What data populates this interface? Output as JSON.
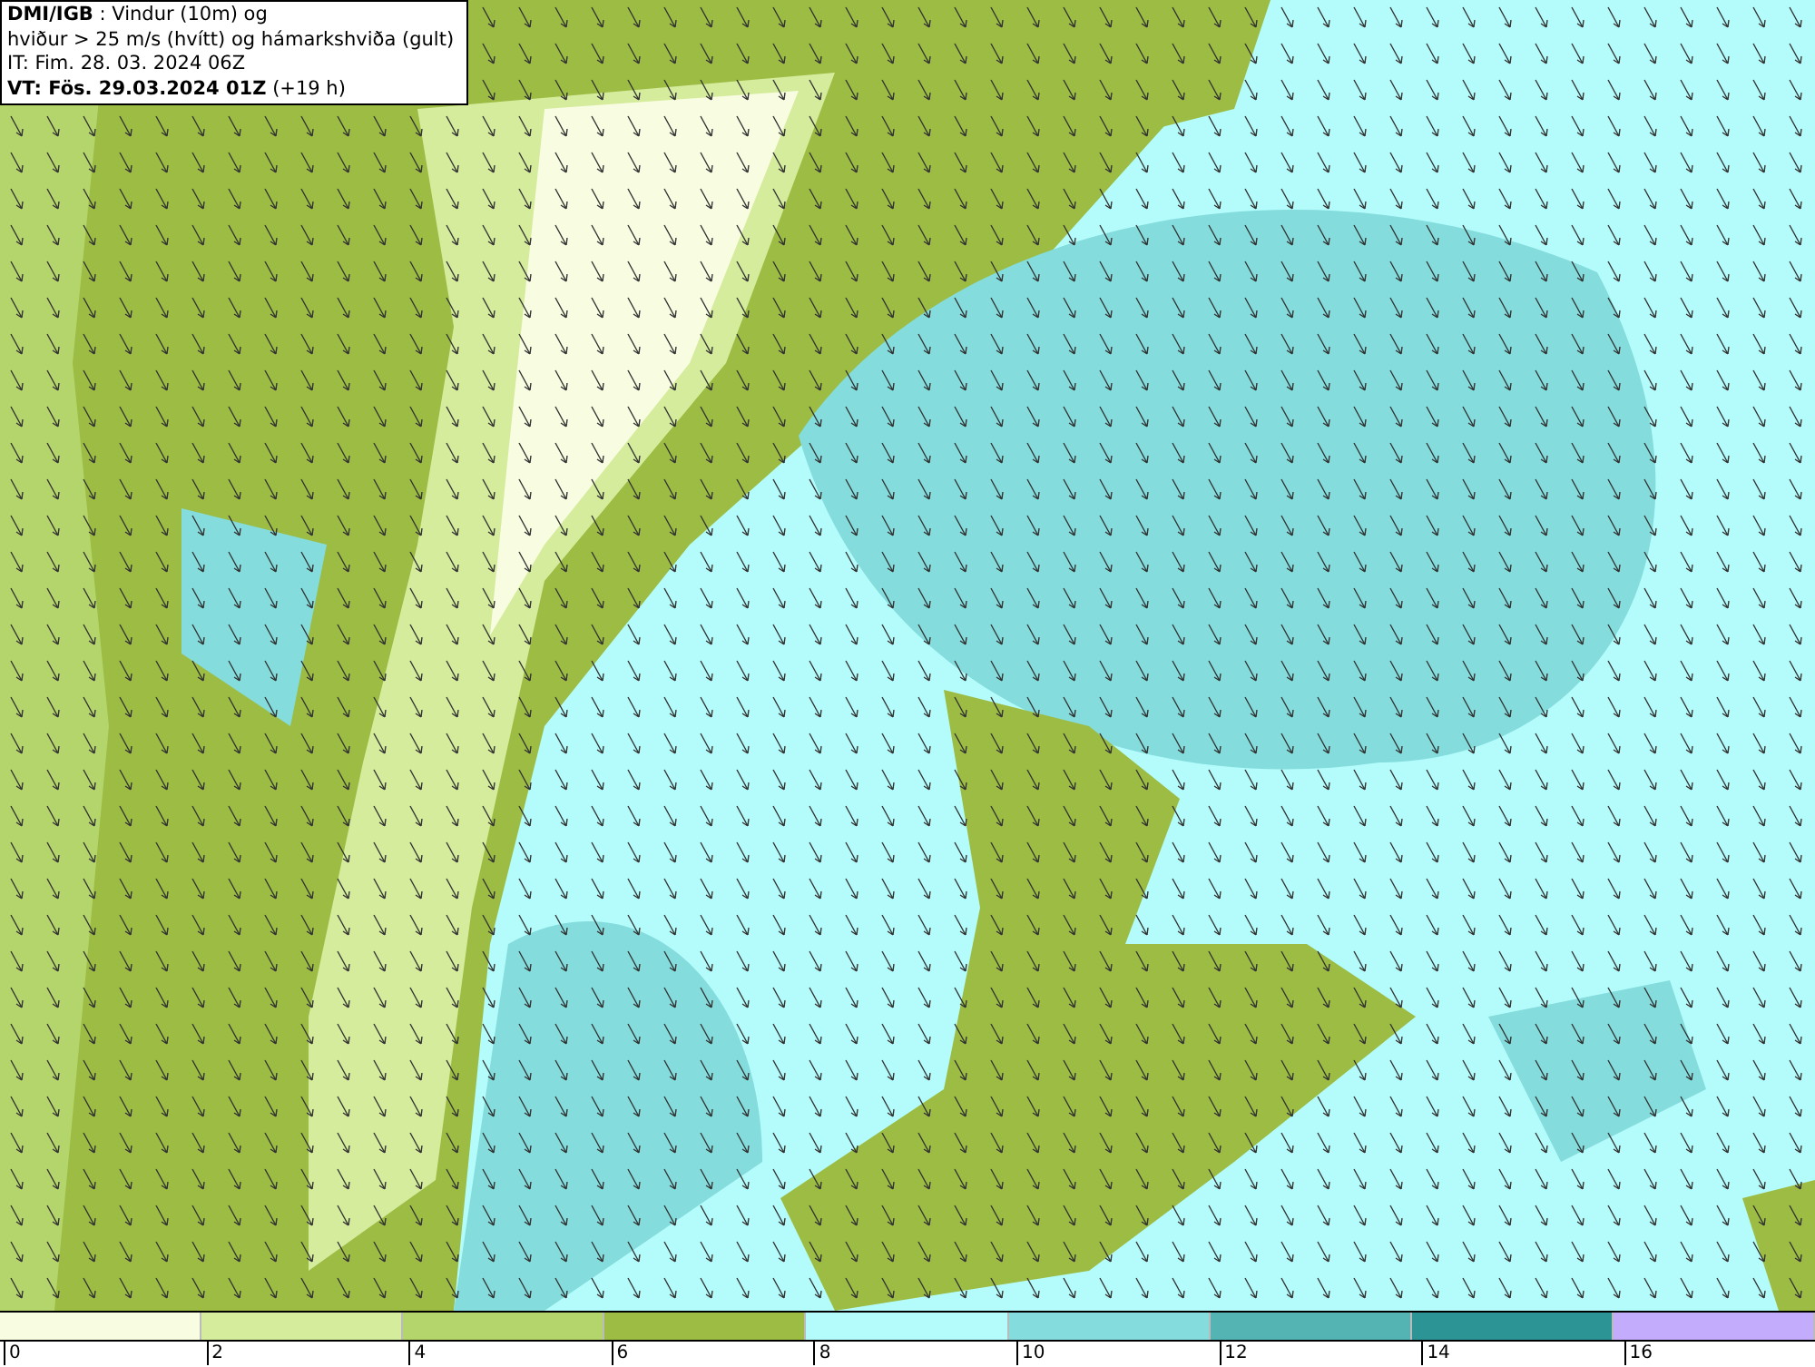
{
  "header": {
    "lines": [
      "**DMI/IGB** : Vindur (10m) og",
      "hviður > 25 m/s (hvítt) og hámarkshviða (gult)",
      "IT: Fim. 28. 03. 2024 06Z",
      "**VT: Fös. 29.03.2024 01Z** (+19 h)"
    ]
  },
  "legend": {
    "bins": [
      {
        "color": "#f8fce0"
      },
      {
        "color": "#d4ec9c"
      },
      {
        "color": "#b4d46c"
      },
      {
        "color": "#9cbc44"
      },
      {
        "color": "#b4fcfc"
      },
      {
        "color": "#84dcdc"
      },
      {
        "color": "#54b4b4"
      },
      {
        "color": "#2c9494"
      },
      {
        "color": "#c4acfc"
      }
    ],
    "labels": [
      "0",
      "2",
      "4",
      "6",
      "8",
      "10",
      "12",
      "14",
      "16"
    ]
  }
}
